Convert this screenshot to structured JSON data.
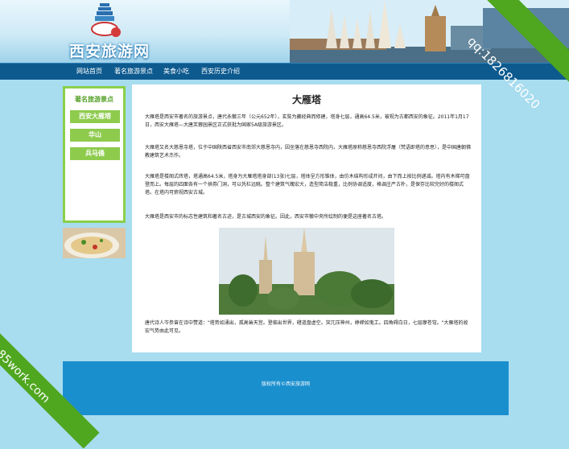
{
  "header": {
    "logo_text": "西安旅游网"
  },
  "nav": {
    "items": [
      {
        "label": "网站首页"
      },
      {
        "label": "著名旅游景点"
      },
      {
        "label": "美食小吃"
      },
      {
        "label": "西安历史介绍"
      }
    ]
  },
  "sidebar": {
    "title": "著名旅游景点",
    "items": [
      {
        "label": "西安大雁塔"
      },
      {
        "label": "华山"
      },
      {
        "label": "兵马俑"
      }
    ]
  },
  "article": {
    "title": "大雁塔",
    "paragraphs": [
      "大雁塔是西安市著名的旅游景点，唐代永徽三年（公元652年），玄奘为藏经典而修建，塔身七层，通高64.5米，被视为古都西安的象征。2011年1月17日，西安大雁塔—大唐芙蓉园景区正式获批为国家5A级旅游景区。",
      "大雁塔又名大慈恩寺塔，位于中国陕西省西安市南郊大慈恩寺内，因坐落在慈恩寺西院内，大雁塔原称慈恩寺西院浮屠（梵语即塔的意思），是中国唐朝佛教建筑艺术杰作。",
      "大雁塔是楼阁式砖塔，塔通高64.5米，塔身为大雁塔塔身部(13张)七层，塔体呈方形锥体，由仿木结构形成开间，由下而上按比例递减。塔内有木梯可盘登而上。每层的四面各有一个拱券门洞，可以凭栏远眺。整个建筑气魄宏大，造型简洁稳重，比例协调适度，格调庄严古朴，是保存比较完好的楼阁式塔。在塔内可俯视西安古城。",
      "大雁塔是西安市的标志性建筑和著名古迹，是古城西安的象征。因此，西安市徽中央所绘制的便是这座著名古塔。",
      "唐代诗人岑参曾在诗中赞道：\"塔势如涌出，孤高耸天宫。登临出世界，磴道盘虚空。突兀压神州，峥嵘如鬼工。四角碍白日，七层摩苍穹。\"大雁塔的故宏气势由此可见。"
    ]
  },
  "footer": {
    "copyright": "版权所有©西安旅游网"
  },
  "watermarks": {
    "top_right": "qq:1826816020",
    "bottom_left": "85work.com"
  },
  "colors": {
    "nav_bg": "#0d5a8f",
    "sidebar_accent": "#8ecb4d",
    "footer_bg": "#1a8fce",
    "page_bg": "#a8dcef"
  }
}
